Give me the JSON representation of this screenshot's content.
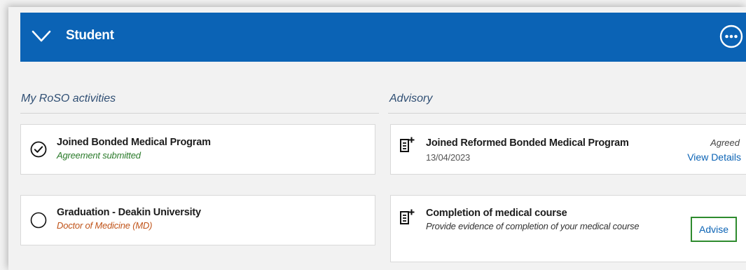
{
  "header": {
    "title": "Student"
  },
  "roso": {
    "title": "My RoSO activities",
    "items": [
      {
        "title": "Joined Bonded Medical Program",
        "subtitle": "Agreement submitted",
        "state": "completed"
      },
      {
        "title": "Graduation - Deakin University",
        "subtitle": "Doctor of Medicine (MD)",
        "state": "pending"
      }
    ]
  },
  "advisory": {
    "title": "Advisory",
    "items": [
      {
        "title": "Joined Reformed Bonded Medical Program",
        "date": "13/04/2023",
        "status": "Agreed",
        "link": "View Details"
      },
      {
        "title": "Completion of medical course",
        "subtitle": "Provide evidence of completion of your medical course",
        "action": "Advise"
      }
    ]
  },
  "colors": {
    "header_bg": "#0b63b5",
    "completed_text": "#2a7a2a",
    "pending_text": "#c0541a",
    "link": "#0b63b5"
  },
  "icons": [
    "chevron-down-icon",
    "more-options-icon",
    "check-circle-icon",
    "empty-circle-icon",
    "document-add-icon"
  ]
}
